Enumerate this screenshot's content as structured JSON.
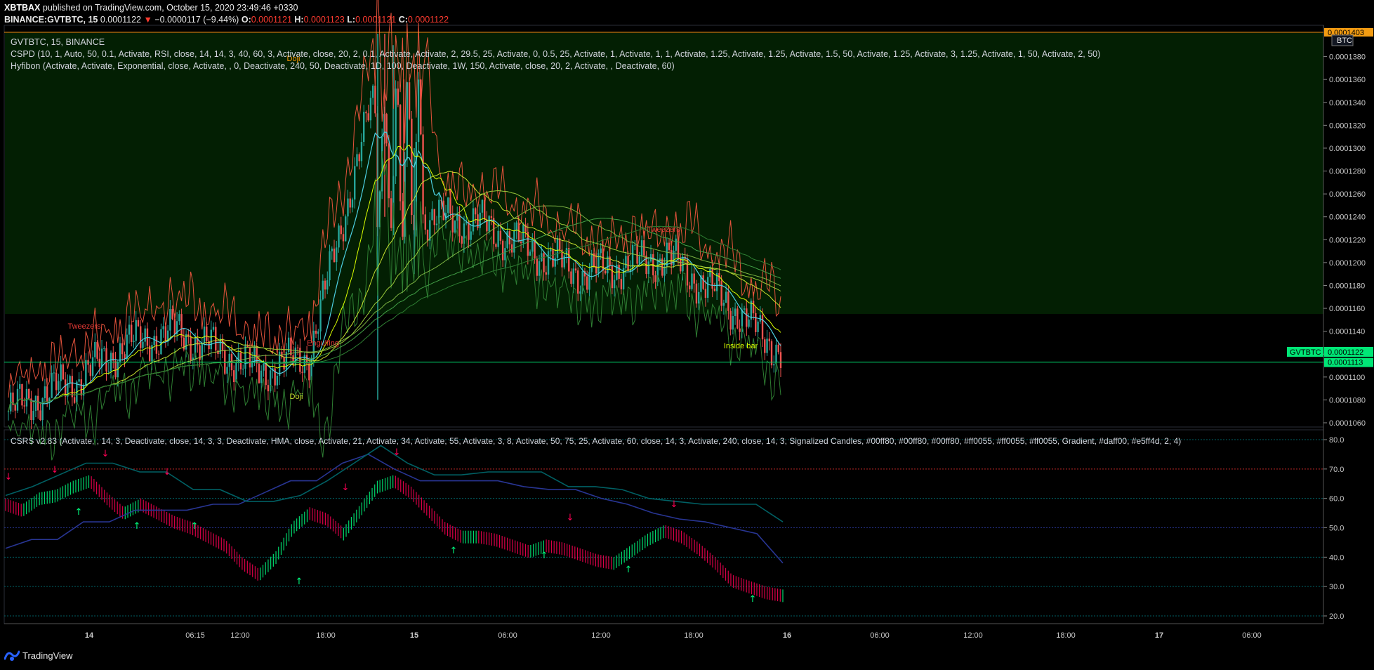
{
  "header": {
    "publisher": "XBTBAX",
    "published_text": "published on TradingView.com, October 15, 2020 23:49:46 +0330",
    "symbol_line": "BINANCE:GVTBTC, 15",
    "last": "0.0001122",
    "change": "−0.0000117 (−9.44%)",
    "o_label": "O:",
    "o": "0.0001121",
    "h_label": "H:",
    "h": "0.0001123",
    "l_label": "L:",
    "l": "0.0001121",
    "c_label": "C:",
    "c": "0.0001122"
  },
  "legends": {
    "main_title": "GVTBTC, 15, BINANCE",
    "cspd": "CSPD (10, 1, Auto, 50, 0.1, Activate, RSI, close, 14, 14, 3, 40, 60, 3, Activate, close, 20, 2, 0.1, Activate, Activate, 2, 29.5, 25, Activate, 0, 0.5, 25, Activate, 1, Activate, 1, 1, Activate, 1.25, Activate, 1.25, Activate, 1.5, 50, Activate, 1.25, Activate, 3, 1.25, Activate, 1, 50, Activate, 2, 50)",
    "hyfibon": "Hyfibon (Activate, Activate, Exponential, close, Activate, , 0, Deactivate, 240, 50, Deactivate, 1D, 100, Deactivate, 1W, 150, Activate, close, 20, 2, Activate, , Deactivate, 60)",
    "csrs": "CSRS v2.83 (Activate, , 14, 3, Deactivate, close, 14, 3, 3, Deactivate, HMA, close, Activate, 21, Activate, 34, Activate, 55, Activate, 3, 8, Activate, 50, 75, 25, Activate, 60, close, 14, 3, Activate, 240, close, 14, 3, Signalized Candles, #00ff80, #00ff80, #00ff80, #ff0055, #ff0055, #ff0055, Gradient, #daff00, #e5ff4d, 2, 4)"
  },
  "annotations": {
    "tweezers": "Tweezers",
    "engulfing": "Engulfing",
    "doji": "Doji",
    "inside_bar": "Inside bar"
  },
  "price_axis": {
    "currency_badge": "BTC",
    "top_label": "0.0001403",
    "ticks": [
      "0.0001380",
      "0.0001360",
      "0.0001340",
      "0.0001320",
      "0.0001300",
      "0.0001280",
      "0.0001260",
      "0.0001240",
      "0.0001220",
      "0.0001200",
      "0.0001180",
      "0.0001160",
      "0.0001140",
      "0.0001120",
      "0.0001100",
      "0.0001080",
      "0.0001060"
    ],
    "symbol_badge": "GVTBTC",
    "last_price": "0.0001122",
    "line_price": "0.0001113"
  },
  "rsi_axis": {
    "ticks": [
      "80.0",
      "70.0",
      "60.0",
      "50.0",
      "40.0",
      "30.0",
      "20.0"
    ]
  },
  "time_axis": {
    "ticks": [
      "14",
      "06:15",
      "12:00",
      "18:00",
      "15",
      "06:00",
      "12:00",
      "18:00",
      "16",
      "06:00",
      "12:00",
      "18:00",
      "17",
      "06:00"
    ]
  },
  "footer": {
    "brand": "TradingView"
  },
  "colors": {
    "bull": "#26a69a",
    "bear": "#ef5350",
    "rsi_up": "#00ff80",
    "rsi_down": "#ff0055",
    "upper_band": "#e5533c",
    "mid_band": "#4dd0e1",
    "fib": "#daff00",
    "price_line": "#00e676",
    "rsi_slow": "#283593",
    "rsi_fast": "#006064"
  },
  "chart_data": {
    "type": "candlestick",
    "timeframe": "15",
    "symbol": "GVTBTC",
    "ylim": [
      0.0001053,
      0.0001405
    ],
    "last_price": 0.0001122,
    "support_line": 0.0001113,
    "bullish_zone_above": 0.000116,
    "candles_approx": [
      {
        "t": "13 23:00",
        "o": 0.0001066,
        "h": 0.0001075,
        "l": 0.000106,
        "c": 0.000107
      },
      {
        "t": "14 00:00",
        "o": 0.0001078,
        "h": 0.0001106,
        "l": 0.0001075,
        "c": 0.0001098
      },
      {
        "t": "14 03:00",
        "o": 0.000111,
        "h": 0.000114,
        "l": 0.0001103,
        "c": 0.0001128
      },
      {
        "t": "14 06:15",
        "o": 0.0001138,
        "h": 0.0001146,
        "l": 0.0001126,
        "c": 0.000114
      },
      {
        "t": "14 12:00",
        "o": 0.0001128,
        "h": 0.0001133,
        "l": 0.0001118,
        "c": 0.000112
      },
      {
        "t": "14 15:00",
        "o": 0.0001112,
        "h": 0.0001118,
        "l": 0.0001097,
        "c": 0.0001105
      },
      {
        "t": "14 18:00",
        "o": 0.000111,
        "h": 0.0001126,
        "l": 0.0001104,
        "c": 0.0001118
      },
      {
        "t": "14 21:00",
        "o": 0.0001122,
        "h": 0.0001395,
        "l": 0.0001118,
        "c": 0.000134
      },
      {
        "t": "15 00:00",
        "o": 0.000132,
        "h": 0.000135,
        "l": 0.00012,
        "c": 0.000124
      },
      {
        "t": "15 03:00",
        "o": 0.000123,
        "h": 0.0001245,
        "l": 0.0001216,
        "c": 0.0001235
      },
      {
        "t": "15 06:00",
        "o": 0.0001232,
        "h": 0.000124,
        "l": 0.0001205,
        "c": 0.0001216
      },
      {
        "t": "15 12:00",
        "o": 0.0001205,
        "h": 0.0001208,
        "l": 0.0001184,
        "c": 0.000119
      },
      {
        "t": "15 16:30",
        "o": 0.0001198,
        "h": 0.0001225,
        "l": 0.000119,
        "c": 0.0001205
      },
      {
        "t": "15 19:00",
        "o": 0.0001186,
        "h": 0.0001188,
        "l": 0.0001165,
        "c": 0.0001168
      },
      {
        "t": "15 23:30",
        "o": 0.0001126,
        "h": 0.000113,
        "l": 0.0001118,
        "c": 0.0001122
      }
    ],
    "rsi": {
      "ylim": [
        16,
        82
      ],
      "levels": [
        80,
        70,
        50,
        30,
        20
      ],
      "values": [
        60,
        58,
        62,
        63,
        66,
        68,
        62,
        57,
        60,
        57,
        54,
        52,
        49,
        46,
        40,
        36,
        42,
        52,
        57,
        55,
        50,
        58,
        66,
        68,
        64,
        58,
        52,
        49,
        49,
        48,
        46,
        44,
        46,
        45,
        43,
        41,
        40,
        44,
        48,
        51,
        49,
        45,
        40,
        34,
        32,
        30,
        29
      ],
      "slow_line": [
        43,
        46,
        46,
        52,
        52,
        56,
        56,
        56,
        58,
        58,
        62,
        66,
        66,
        72,
        75,
        70,
        66,
        66,
        66,
        66,
        64,
        63,
        63,
        60,
        58,
        55,
        53,
        52,
        50,
        48,
        38
      ],
      "fast_line": [
        61,
        64,
        68,
        72,
        72,
        69,
        69,
        63,
        63,
        59,
        59,
        61,
        66,
        72,
        78,
        72,
        68,
        68,
        69,
        69,
        69,
        64,
        64,
        63,
        60,
        59,
        58,
        58,
        58,
        52
      ]
    }
  }
}
